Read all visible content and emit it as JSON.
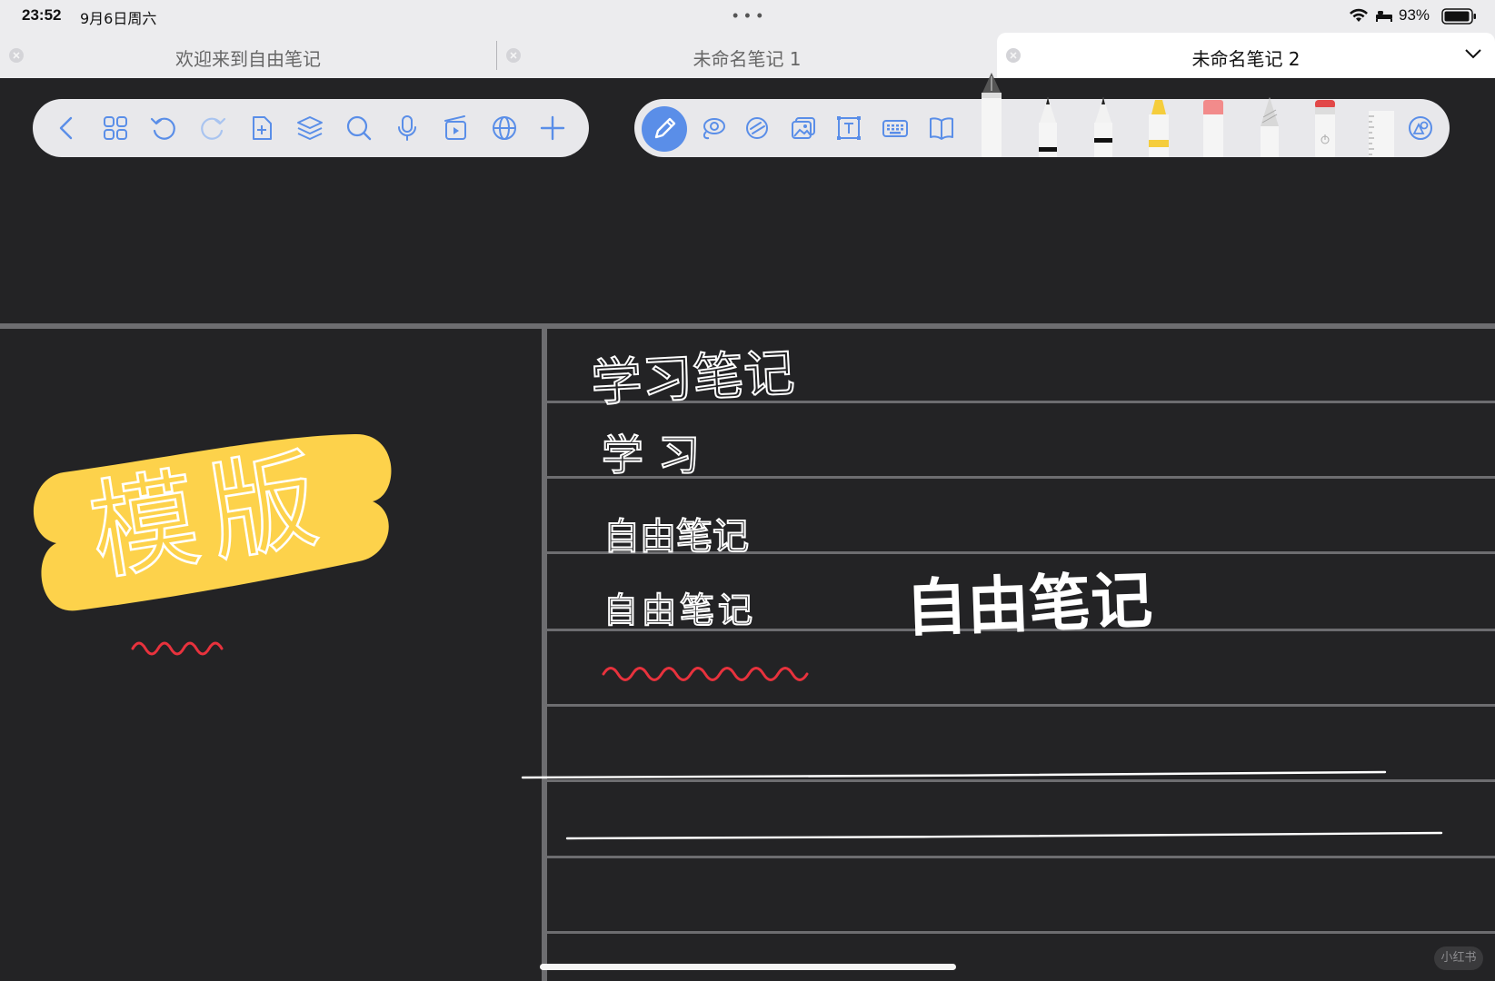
{
  "status_bar": {
    "time": "23:52",
    "date": "9月6日周六",
    "battery_percent": "93%"
  },
  "tabs": [
    {
      "label": "欢迎来到自由笔记",
      "active": false
    },
    {
      "label": "未命名笔记 1",
      "active": false
    },
    {
      "label": "未命名笔记 2",
      "active": true
    }
  ],
  "left_toolbar": {
    "buttons": [
      "chevron-left-icon",
      "grid-icon",
      "undo-icon",
      "redo-icon",
      "add-page-icon",
      "layers-icon",
      "search-icon",
      "microphone-icon",
      "media-icon",
      "globe-icon",
      "plus-icon"
    ]
  },
  "right_toolbar": {
    "tools": [
      "pencil-icon",
      "lasso-icon",
      "shape-icon",
      "image-icon",
      "text-box-icon",
      "keyboard-icon",
      "book-icon"
    ],
    "pens": [
      "fountain-pen",
      "fineliner-black",
      "ballpoint-black",
      "highlighter-yellow",
      "eraser-pink",
      "pencil-grey",
      "eraser-red",
      "ruler",
      "color-palette-icon"
    ]
  },
  "canvas": {
    "handwriting": {
      "heading": "学习笔记",
      "line2": "学习",
      "line3": "自由笔记",
      "line4": "自由笔记",
      "line4_bold": "自由笔记",
      "sticker": "模版"
    },
    "colors": {
      "background": "#232325",
      "sticker": "#fdd24b",
      "wave": "#e8323d",
      "ink": "#ffffff",
      "accent": "#5a8ee8"
    }
  },
  "watermark": "小红书"
}
